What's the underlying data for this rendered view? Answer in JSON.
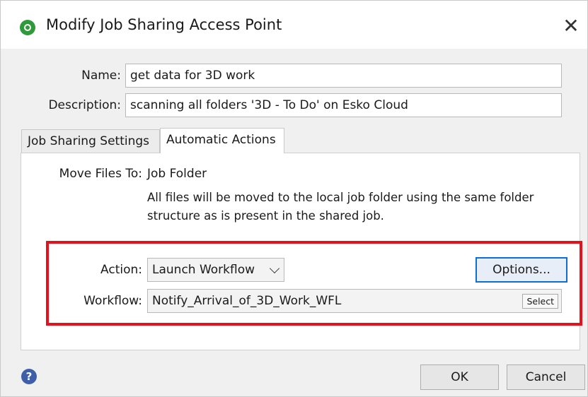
{
  "window": {
    "title": "Modify Job Sharing Access Point",
    "app_icon": "green-circle-icon",
    "close_icon": "close-icon",
    "close_glyph": "✕"
  },
  "form": {
    "name_label": "Name:",
    "name_value": "get data for 3D work",
    "description_label": "Description:",
    "description_value": "scanning all folders '3D - To Do' on Esko Cloud"
  },
  "tabs": [
    {
      "label": "Job Sharing Settings",
      "active": false
    },
    {
      "label": "Automatic Actions",
      "active": true
    }
  ],
  "panel": {
    "move_label": "Move Files To:",
    "move_value": "Job Folder",
    "move_description": "All files will be moved to the local job folder using the same folder structure as is present in the shared job.",
    "action_label": "Action:",
    "action_value": "Launch Workflow",
    "options_button": "Options...",
    "workflow_label": "Workflow:",
    "workflow_value": "Notify_Arrival_of_3D_Work_WFL",
    "select_button": "Select",
    "highlight_color": "#e3121c"
  },
  "footer": {
    "help_icon": "help-icon",
    "help_glyph": "?",
    "ok_button": "OK",
    "cancel_button": "Cancel"
  },
  "colors": {
    "accent_focus": "#0d6fd1",
    "app_icon_green": "#2e9a3c"
  }
}
